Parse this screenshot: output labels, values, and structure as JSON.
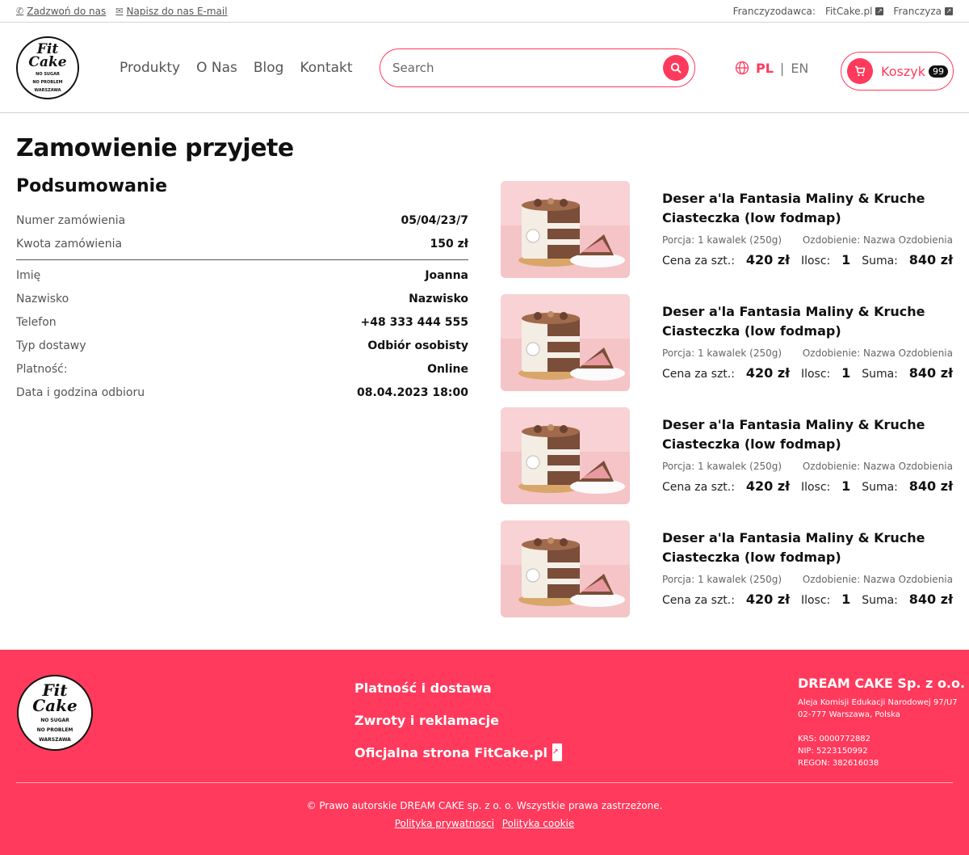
{
  "topbar": {
    "call_label": "Zadzwoń do nas",
    "email_label": "Napisz do nas E-mail",
    "franchisor_label": "Franczyzodawca:",
    "fitcake_link": "FitCake.pl",
    "franchise_link": "Franczyza"
  },
  "logo": {
    "line1": "Fit",
    "line2": "Cake",
    "line3": "NO SUGAR",
    "line4": "NO PROBLEM",
    "line5": "WARSZAWA"
  },
  "nav": {
    "items": [
      "Produkty",
      "O Nas",
      "Blog",
      "Kontakt"
    ]
  },
  "search": {
    "placeholder": "Search"
  },
  "lang": {
    "pl": "PL",
    "sep": "|",
    "en": "EN"
  },
  "cart": {
    "label": "Koszyk",
    "count": "99"
  },
  "page": {
    "title": "Zamowienie przyjete",
    "subtitle": "Podsumowanie"
  },
  "summary": {
    "order_rows": [
      {
        "key": "Numer zamówienia",
        "value": "05/04/23/7"
      },
      {
        "key": "Kwota zamówienia",
        "value": "150 zł"
      }
    ],
    "detail_rows": [
      {
        "key": "Imię",
        "value": "Joanna"
      },
      {
        "key": "Nazwisko",
        "value": "Nazwisko"
      },
      {
        "key": "Telefon",
        "value": "+48 333 444 555"
      },
      {
        "key": "Typ dostawy",
        "value": "Odbiór osobisty"
      },
      {
        "key": "Platność:",
        "value": "Online"
      },
      {
        "key": "Data i godzina odbioru",
        "value": "08.04.2023 18:00"
      }
    ]
  },
  "products": [
    {
      "name": "Deser a'la Fantasia Maliny & Kruche Ciasteczka (low fodmap)",
      "portion": "Porcja: 1 kawalek (250g)",
      "decoration": "Ozdobienie: Nazwa Ozdobienia",
      "price_label": "Cena za szt.:",
      "price": "420 zł",
      "qty_label": "Ilosc:",
      "qty": "1",
      "sum_label": "Suma:",
      "sum": "840 zł"
    },
    {
      "name": "Deser a'la Fantasia Maliny & Kruche Ciasteczka (low fodmap)",
      "portion": "Porcja: 1 kawalek (250g)",
      "decoration": "Ozdobienie: Nazwa Ozdobienia",
      "price_label": "Cena za szt.:",
      "price": "420 zł",
      "qty_label": "Ilosc:",
      "qty": "1",
      "sum_label": "Suma:",
      "sum": "840 zł"
    },
    {
      "name": "Deser a'la Fantasia Maliny & Kruche Ciasteczka (low fodmap)",
      "portion": "Porcja: 1 kawalek (250g)",
      "decoration": "Ozdobienie: Nazwa Ozdobienia",
      "price_label": "Cena za szt.:",
      "price": "420 zł",
      "qty_label": "Ilosc:",
      "qty": "1",
      "sum_label": "Suma:",
      "sum": "840 zł"
    },
    {
      "name": "Deser a'la Fantasia Maliny & Kruche Ciasteczka (low fodmap)",
      "portion": "Porcja: 1 kawalek (250g)",
      "decoration": "Ozdobienie: Nazwa Ozdobienia",
      "price_label": "Cena za szt.:",
      "price": "420 zł",
      "qty_label": "Ilosc:",
      "qty": "1",
      "sum_label": "Suma:",
      "sum": "840 zł"
    }
  ],
  "footer": {
    "links": [
      "Platność i dostawa",
      "Zwroty i reklamacje",
      "Oficjalna strona FitCake.pl"
    ],
    "company": {
      "name": "DREAM CAKE Sp. z o.o.",
      "address1": "Aleja Komisji Edukacji Narodowej 97/U7",
      "address2": "02-777 Warszawa, Polska",
      "krs": "KRS: 0000772882",
      "nip": "NIP: 5223150992",
      "regon": "REGON: 382616038"
    },
    "copyright": "© Prawo autorskie DREAM CAKE sp. z o. o. Wszystkie prawa zastrzeżone.",
    "privacy": "Polityka prywatnosci",
    "cookie": "Polityka cookie"
  },
  "colors": {
    "accent": "#ff3a5c",
    "text": "#111111",
    "muted": "#555555"
  },
  "icons": {
    "phone": "phone-icon",
    "mail": "mail-icon",
    "external": "external-link-icon",
    "search": "search-icon",
    "globe": "globe-icon",
    "cart": "cart-icon"
  }
}
